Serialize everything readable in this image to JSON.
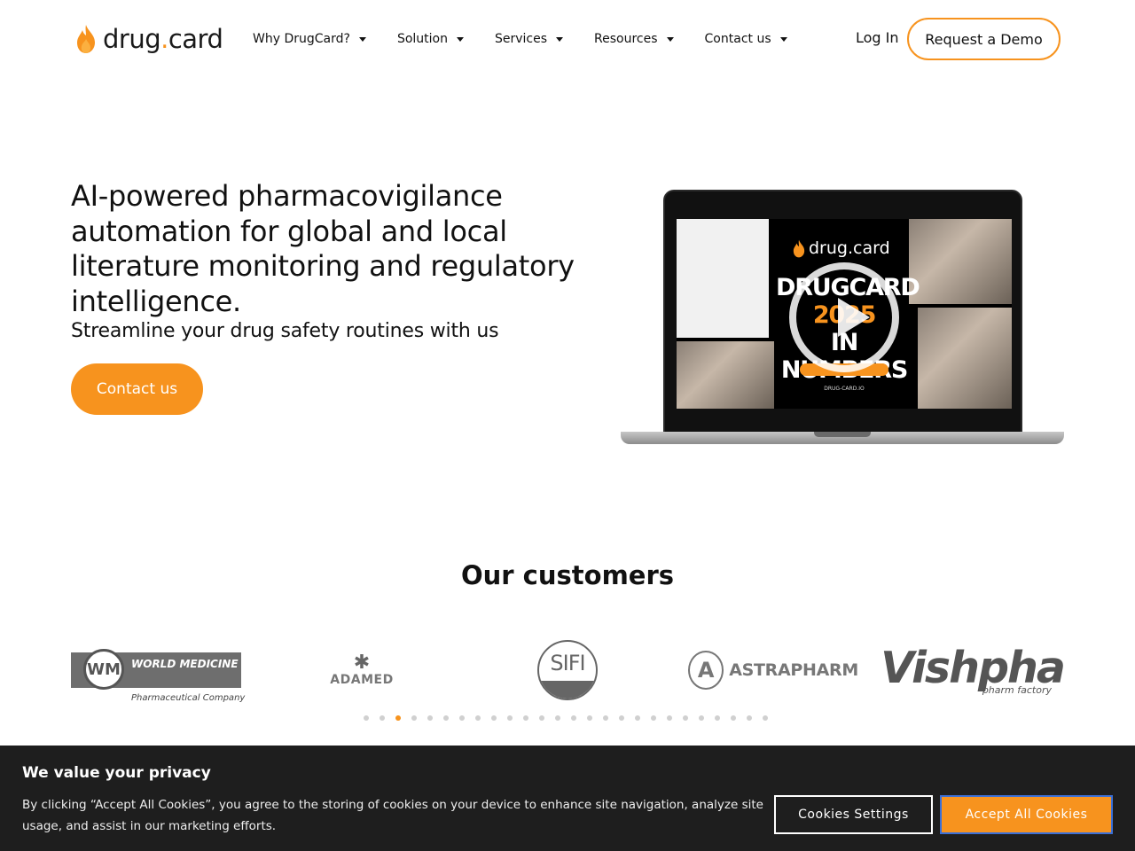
{
  "brand": {
    "name_part1": "drug",
    "name_dot": ".",
    "name_part2": "card",
    "accent_color": "#f7931e"
  },
  "nav": {
    "items": [
      {
        "label": "Why DrugCard?"
      },
      {
        "label": "Solution"
      },
      {
        "label": "Services"
      },
      {
        "label": "Resources"
      },
      {
        "label": "Contact us"
      }
    ],
    "login_label": "Log In",
    "demo_label": "Request a Demo"
  },
  "hero": {
    "title": "AI-powered pharmacovigilance automation for global and local literature monitoring and regulatory intelligence.",
    "subtitle": "Streamline your drug safety routines with us",
    "cta_label": "Contact us",
    "video": {
      "brand": "drug.card",
      "headline_line1": "DRUGCARD",
      "headline_year": "2025",
      "headline_line3": "IN NUMBERS",
      "url": "DRUG-CARD.IO"
    }
  },
  "customers": {
    "title": "Our customers",
    "logos": [
      {
        "name": "WORLD MEDICINE",
        "tagline": "Pharmaceutical Company",
        "initials": "WM"
      },
      {
        "name": "ADAMED",
        "icon": "asterisk-icon"
      },
      {
        "name": "SIFI"
      },
      {
        "name": "ASTRAPHARM",
        "initial": "A"
      },
      {
        "name": "Vishpha",
        "tagline": "pharm factory"
      }
    ],
    "carousel": {
      "dot_count": 26,
      "active_index": 2
    }
  },
  "cookie": {
    "title": "We value your privacy",
    "text": "By clicking “Accept All Cookies”, you agree to the storing of cookies on your device to enhance site navigation, analyze site usage, and assist in our marketing efforts.",
    "settings_label": "Cookies Settings",
    "accept_label": "Accept All Cookies"
  }
}
